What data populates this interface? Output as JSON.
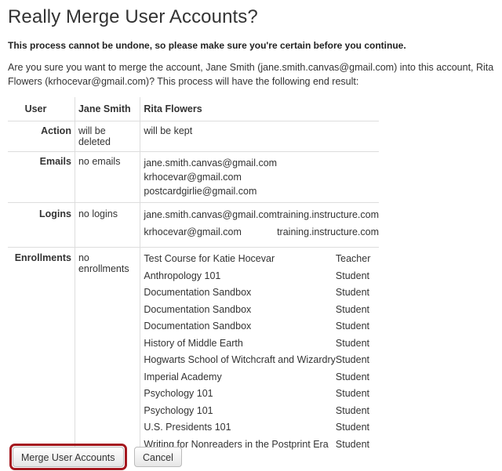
{
  "title": "Really Merge User Accounts?",
  "warning": "This process cannot be undone, so please make sure you're certain before you continue.",
  "description": "Are you sure you want to merge the account, Jane Smith (jane.smith.canvas@gmail.com) into this account, Rita Flowers (krhocevar@gmail.com)? This process will have the following end result:",
  "table": {
    "headers": {
      "label": "User",
      "jane": "Jane Smith",
      "rita": "Rita Flowers"
    },
    "action": {
      "label": "Action",
      "jane": "will be deleted",
      "rita": "will be kept"
    },
    "emails": {
      "label": "Emails",
      "jane": "no emails",
      "rita": [
        "jane.smith.canvas@gmail.com",
        "krhocevar@gmail.com",
        "postcardgirlie@gmail.com"
      ]
    },
    "logins": {
      "label": "Logins",
      "jane": "no logins",
      "rita": [
        {
          "login": "jane.smith.canvas@gmail.com",
          "domain": "training.instructure.com"
        },
        {
          "login": "krhocevar@gmail.com",
          "domain": "training.instructure.com"
        }
      ]
    },
    "enrollments": {
      "label": "Enrollments",
      "jane": "no enrollments",
      "rita": [
        {
          "course": "Test Course for Katie Hocevar",
          "role": "Teacher"
        },
        {
          "course": "Anthropology 101",
          "role": "Student"
        },
        {
          "course": "Documentation Sandbox",
          "role": "Student"
        },
        {
          "course": "Documentation Sandbox",
          "role": "Student"
        },
        {
          "course": "Documentation Sandbox",
          "role": "Student"
        },
        {
          "course": "History of Middle Earth",
          "role": "Student"
        },
        {
          "course": "Hogwarts School of Witchcraft and Wizardry",
          "role": "Student"
        },
        {
          "course": "Imperial Academy",
          "role": "Student"
        },
        {
          "course": "Psychology 101",
          "role": "Student"
        },
        {
          "course": "Psychology 101",
          "role": "Student"
        },
        {
          "course": "U.S. Presidents 101",
          "role": "Student"
        },
        {
          "course": "Writing for Nonreaders in the Postprint Era",
          "role": "Student"
        }
      ]
    }
  },
  "buttons": {
    "merge": "Merge User Accounts",
    "cancel": "Cancel"
  },
  "colors": {
    "highlight": "#a4181f"
  }
}
